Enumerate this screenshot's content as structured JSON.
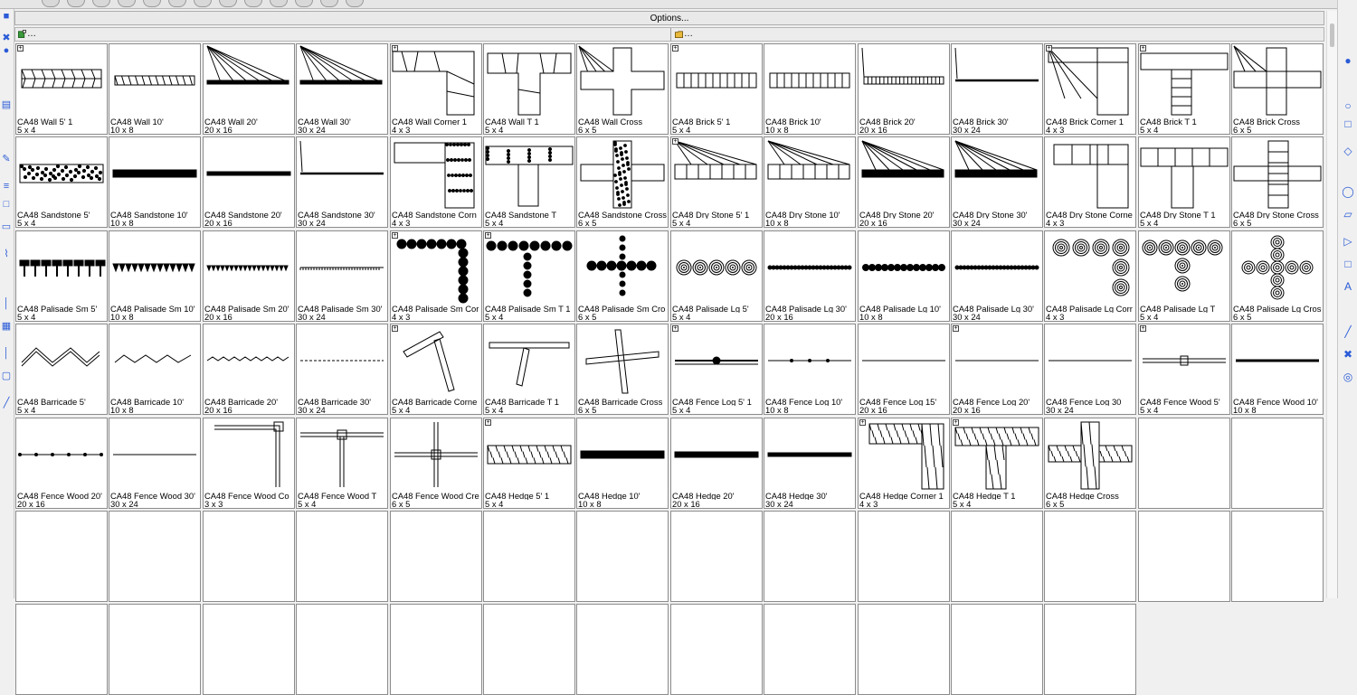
{
  "options_label": "Options...",
  "path_left": "…",
  "path_right": "…",
  "library": [
    {
      "label": "CA48 Wall 5' 1",
      "size": "5 x 4",
      "plus": true,
      "shape": "wall"
    },
    {
      "label": "CA48 Wall 10'",
      "size": "10 x 8",
      "plus": false,
      "shape": "wall-thin"
    },
    {
      "label": "CA48 Wall 20'",
      "size": "20 x 16",
      "plus": false,
      "shape": "wall-fan"
    },
    {
      "label": "CA48 Wall 30'",
      "size": "30 x 24",
      "plus": false,
      "shape": "wall-fan"
    },
    {
      "label": "CA48 Wall Corner 1",
      "size": "4 x 3",
      "plus": true,
      "shape": "corner-stone"
    },
    {
      "label": "CA48 Wall T 1",
      "size": "5 x 4",
      "plus": false,
      "shape": "t-stone"
    },
    {
      "label": "CA48 Wall Cross",
      "size": "6 x 5",
      "plus": false,
      "shape": "cross-stone"
    },
    {
      "label": "CA48 Brick 5' 1",
      "size": "5 x 4",
      "plus": true,
      "shape": "brick"
    },
    {
      "label": "CA48 Brick 10'",
      "size": "10 x 8",
      "plus": false,
      "shape": "brick"
    },
    {
      "label": "CA48 Brick 20'",
      "size": "20 x 16",
      "plus": false,
      "shape": "brick-thin"
    },
    {
      "label": "CA48 Brick 30'",
      "size": "30 x 24",
      "plus": false,
      "shape": "line-thick"
    },
    {
      "label": "CA48 Brick Corner 1",
      "size": "4 x 3",
      "plus": true,
      "shape": "corner-brick"
    },
    {
      "label": "CA48 Brick T 1",
      "size": "5 x 4",
      "plus": true,
      "shape": "t-brick"
    },
    {
      "label": "CA48 Brick Cross",
      "size": "6 x 5",
      "plus": false,
      "shape": "cross-brick"
    },
    {
      "label": "CA48 Sandstone 5'",
      "size": "5 x 4",
      "plus": false,
      "shape": "sand"
    },
    {
      "label": "CA48 Sandstone 10'",
      "size": "10 x 8",
      "plus": false,
      "shape": "sand-mid"
    },
    {
      "label": "CA48 Sandstone 20'",
      "size": "20 x 16",
      "plus": false,
      "shape": "sand-thin"
    },
    {
      "label": "CA48 Sandstone 30'",
      "size": "30 x 24",
      "plus": false,
      "shape": "line-thick"
    },
    {
      "label": "CA48 Sandstone Corn",
      "size": "4 x 3",
      "plus": false,
      "shape": "corner-sand"
    },
    {
      "label": "CA48 Sandstone T",
      "size": "5 x 4",
      "plus": false,
      "shape": "t-sand"
    },
    {
      "label": "CA48 Sandstone Cross",
      "size": "6 x 5",
      "plus": false,
      "shape": "cross-sand"
    },
    {
      "label": "CA48 Dry Stone 5' 1",
      "size": "5 x 4",
      "plus": true,
      "shape": "dry-fan"
    },
    {
      "label": "CA48 Dry Stone 10'",
      "size": "10 x 8",
      "plus": false,
      "shape": "dry-fan"
    },
    {
      "label": "CA48 Dry Stone 20'",
      "size": "20 x 16",
      "plus": false,
      "shape": "dry-fan2"
    },
    {
      "label": "CA48 Dry Stone 30'",
      "size": "30 x 24",
      "plus": false,
      "shape": "dry-fan2"
    },
    {
      "label": "CA48 Dry Stone Corne",
      "size": "4 x 3",
      "plus": false,
      "shape": "corner-dry"
    },
    {
      "label": "CA48 Dry Stone T 1",
      "size": "5 x 4",
      "plus": false,
      "shape": "t-dry"
    },
    {
      "label": "CA48 Dry Stone Cross",
      "size": "6 x 5",
      "plus": false,
      "shape": "cross-dry"
    },
    {
      "label": "CA48 Palisade Sm 5'",
      "size": "5 x 4",
      "plus": false,
      "shape": "pal-sm"
    },
    {
      "label": "CA48 Palisade Sm 10'",
      "size": "10 x 8",
      "plus": false,
      "shape": "pal-sm2"
    },
    {
      "label": "CA48 Palisade Sm 20'",
      "size": "20 x 16",
      "plus": false,
      "shape": "pal-sm3"
    },
    {
      "label": "CA48 Palisade Sm 30'",
      "size": "30 x 24",
      "plus": false,
      "shape": "pal-sm4"
    },
    {
      "label": "CA48 Palisade Sm Cor",
      "size": "4 x 3",
      "plus": true,
      "shape": "corner-pal"
    },
    {
      "label": "CA48 Palisade Sm T 1",
      "size": "5 x 4",
      "plus": true,
      "shape": "t-pal"
    },
    {
      "label": "CA48 Palisade Sm Cro",
      "size": "6 x 5",
      "plus": false,
      "shape": "cross-pal"
    },
    {
      "label": "CA48 Palisade Lg 5'",
      "size": "5 x 4",
      "plus": false,
      "shape": "pal-lg"
    },
    {
      "label": "CA48 Palisade Lg 30'",
      "size": "20 x 16",
      "plus": false,
      "shape": "pal-lg-thin"
    },
    {
      "label": "CA48 Palisade Lg 10'",
      "size": "10 x 8",
      "plus": false,
      "shape": "pal-lg-mid"
    },
    {
      "label": "CA48 Palisade Lg 30'",
      "size": "30 x 24",
      "plus": false,
      "shape": "pal-lg-thin"
    },
    {
      "label": "CA48 Palisade Lg Corr",
      "size": "4 x 3",
      "plus": false,
      "shape": "corner-lg"
    },
    {
      "label": "CA48 Palisade Lg T",
      "size": "5 x 4",
      "plus": false,
      "shape": "t-lg"
    },
    {
      "label": "CA48 Palisade Lg Cros",
      "size": "6 x 5",
      "plus": false,
      "shape": "cross-lg"
    },
    {
      "label": "CA48 Barricade 5'",
      "size": "5 x 4",
      "plus": false,
      "shape": "barr"
    },
    {
      "label": "CA48 Barricade 10'",
      "size": "10 x 8",
      "plus": false,
      "shape": "barr2"
    },
    {
      "label": "CA48 Barricade 20'",
      "size": "20 x 16",
      "plus": false,
      "shape": "barr3"
    },
    {
      "label": "CA48 Barricade 30'",
      "size": "30 x 24",
      "plus": false,
      "shape": "barr4"
    },
    {
      "label": "CA48 Barricade Corne",
      "size": "5 x 4",
      "plus": true,
      "shape": "corner-barr"
    },
    {
      "label": "CA48 Barricade T 1",
      "size": "5 x 4",
      "plus": false,
      "shape": "t-barr"
    },
    {
      "label": "CA48 Barricade Cross",
      "size": "6 x 5",
      "plus": false,
      "shape": "cross-barr"
    },
    {
      "label": "CA48 Fence Log 5' 1",
      "size": "5 x 4",
      "plus": true,
      "shape": "log"
    },
    {
      "label": "CA48 Fence Log 10'",
      "size": "10 x 8",
      "plus": false,
      "shape": "log2"
    },
    {
      "label": "CA48 Fence Log 15'",
      "size": "20 x 16",
      "plus": false,
      "shape": "line"
    },
    {
      "label": "CA48 Fence Log 20'",
      "size": "20 x 16",
      "plus": true,
      "shape": "line"
    },
    {
      "label": "CA48 Fence Log 30",
      "size": "30 x 24",
      "plus": false,
      "shape": "line"
    },
    {
      "label": "CA48 Fence Wood 5'",
      "size": "5 x 4",
      "plus": true,
      "shape": "wood"
    },
    {
      "label": "CA48 Fence Wood 10'",
      "size": "10 x 8",
      "plus": false,
      "shape": "wood-thick"
    },
    {
      "label": "CA48 Fence Wood 20'",
      "size": "20 x 16",
      "plus": false,
      "shape": "wood-dots"
    },
    {
      "label": "CA48 Fence Wood 30'",
      "size": "30 x 24",
      "plus": false,
      "shape": "line"
    },
    {
      "label": "CA48 Fence Wood Co",
      "size": "3 x 3",
      "plus": false,
      "shape": "corner-wood"
    },
    {
      "label": "CA48 Fence Wood T",
      "size": "5 x 4",
      "plus": false,
      "shape": "t-wood"
    },
    {
      "label": "CA48 Fence Wood Cre",
      "size": "6 x 5",
      "plus": false,
      "shape": "cross-wood"
    },
    {
      "label": "CA48 Hedge 5' 1",
      "size": "5 x 4",
      "plus": true,
      "shape": "hedge"
    },
    {
      "label": "CA48 Hedge 10'",
      "size": "10 x 8",
      "plus": false,
      "shape": "hedge2"
    },
    {
      "label": "CA48 Hedge 20'",
      "size": "20 x 16",
      "plus": false,
      "shape": "hedge3"
    },
    {
      "label": "CA48 Hedge 30'",
      "size": "30 x 24",
      "plus": false,
      "shape": "hedge4"
    },
    {
      "label": "CA48 Hedge Corner 1",
      "size": "4 x 3",
      "plus": true,
      "shape": "corner-hedge"
    },
    {
      "label": "CA48 Hedge T 1",
      "size": "5 x 4",
      "plus": true,
      "shape": "t-hedge"
    },
    {
      "label": "CA48 Hedge Cross",
      "size": "6 x 5",
      "plus": false,
      "shape": "cross-hedge"
    }
  ],
  "empty_cells": 28
}
